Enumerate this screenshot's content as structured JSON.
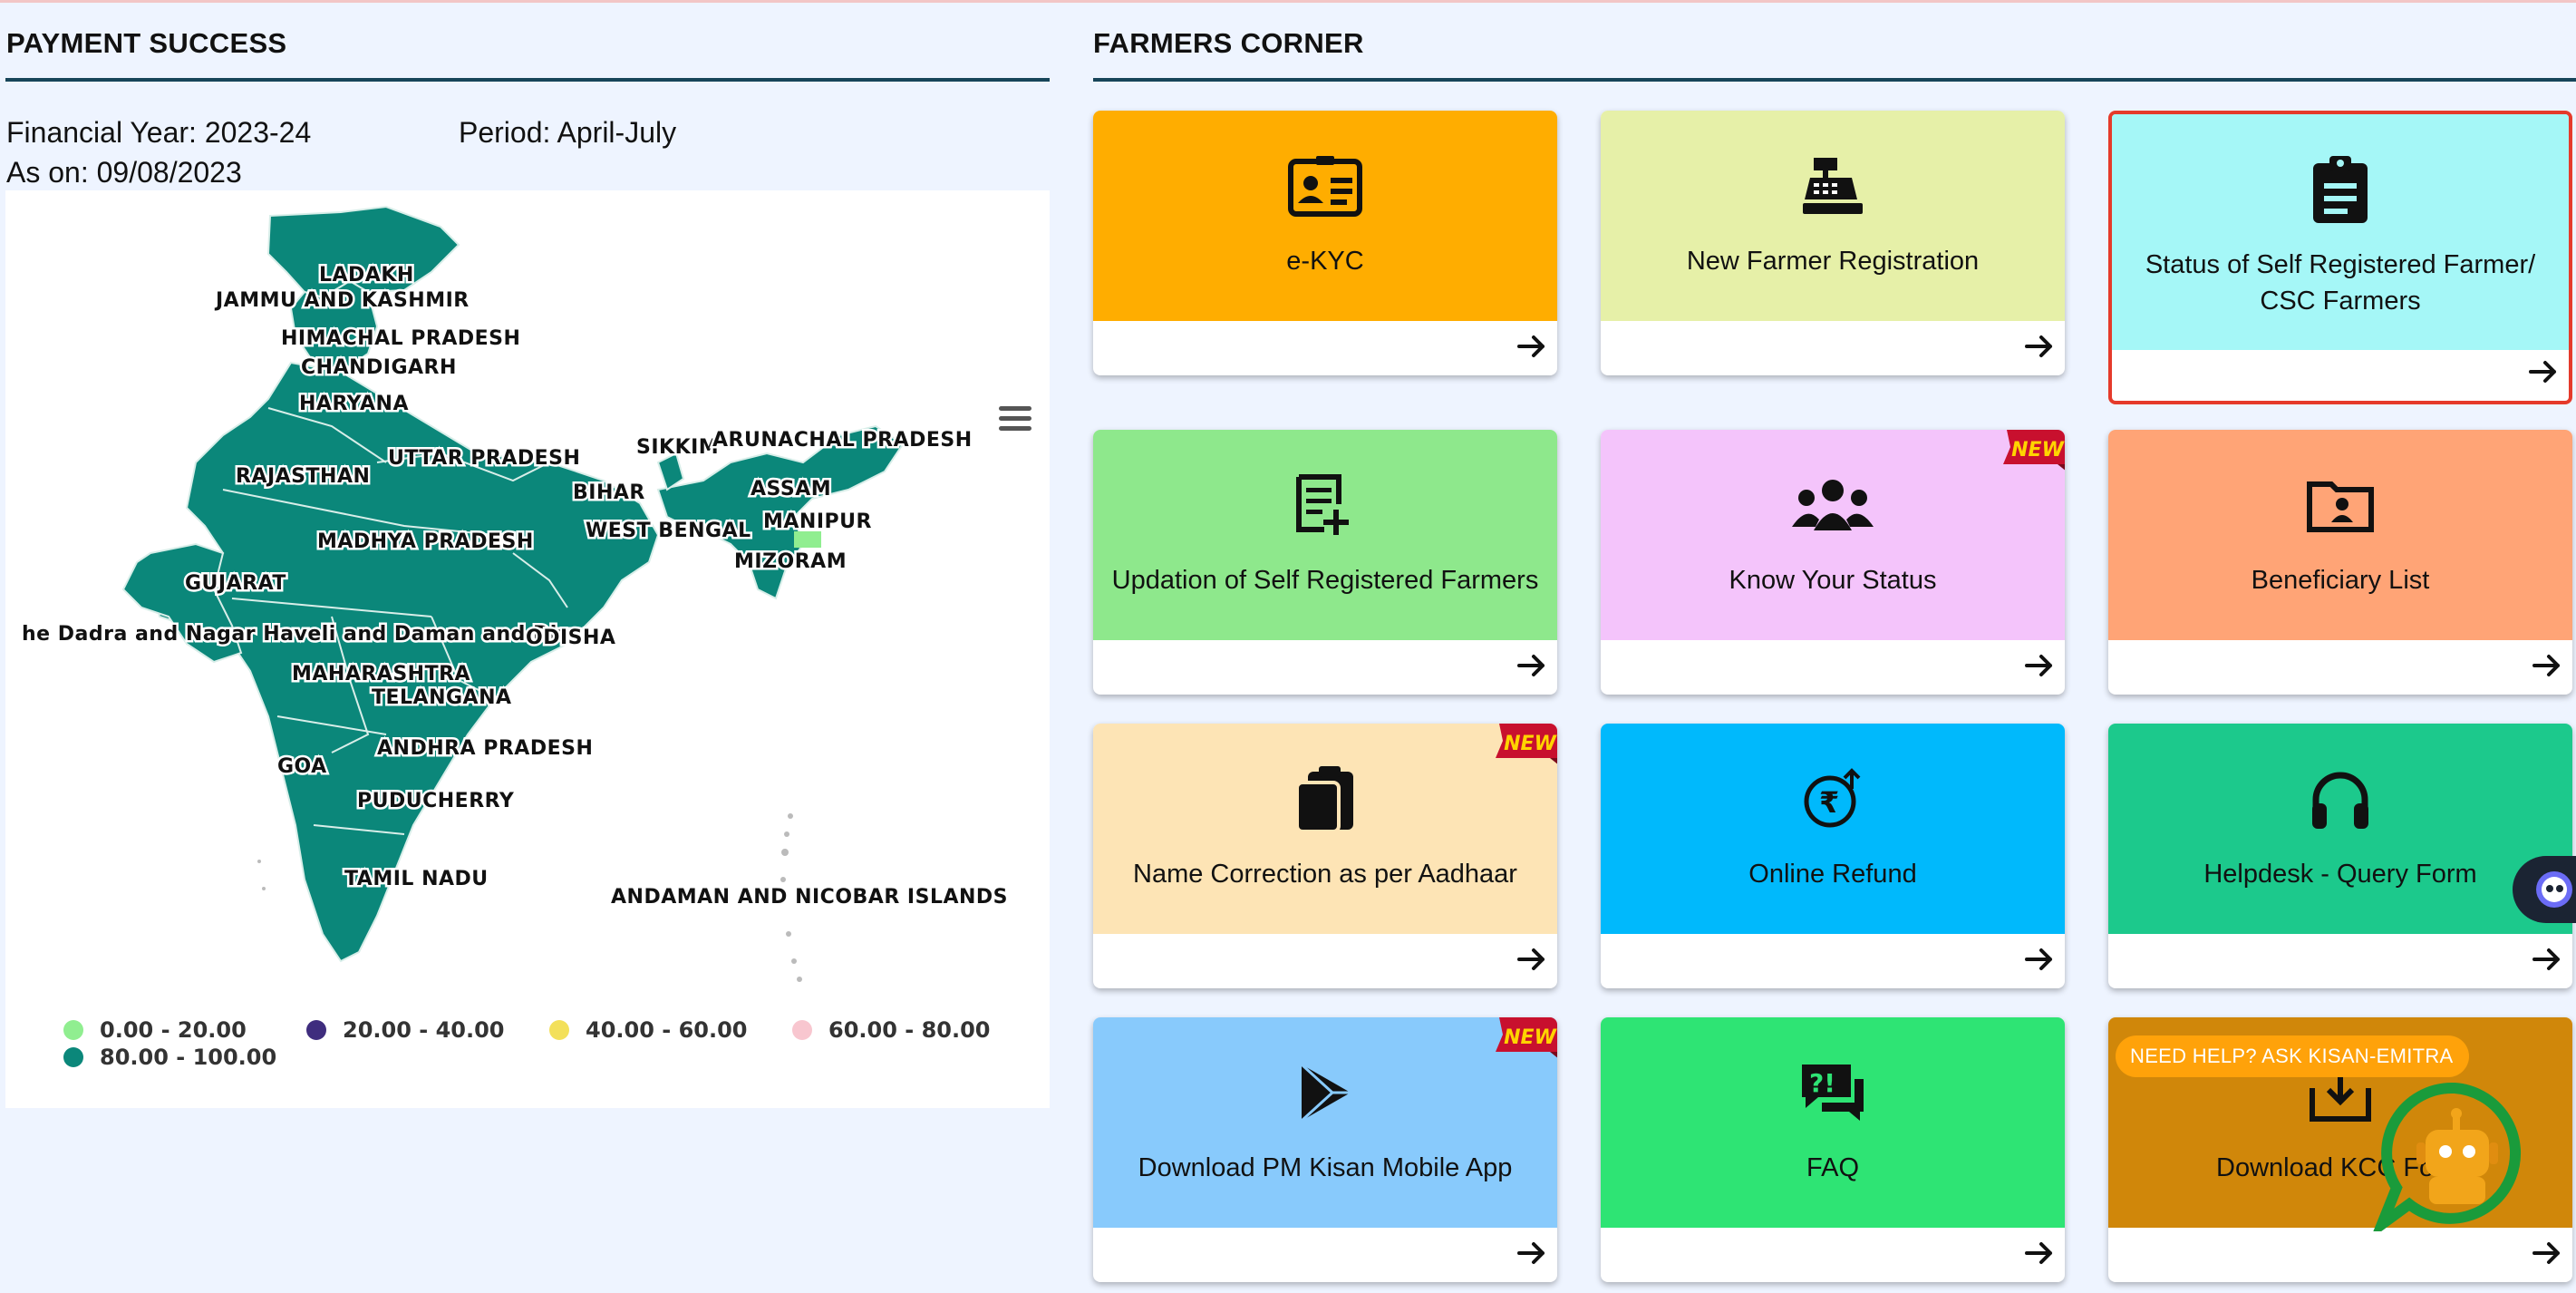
{
  "payment": {
    "title": "PAYMENT SUCCESS",
    "financial_year": "Financial Year: 2023-24",
    "period": "Period: April-July",
    "as_on": "As on: 09/08/2023",
    "state_labels": {
      "ladakh": "LADAKH",
      "jk": "JAMMU AND KASHMIR",
      "hp": "HIMACHAL PRADESH",
      "chandigarh": "CHANDIGARH",
      "haryana": "HARYANA",
      "up": "UTTAR PRADESH",
      "rajasthan": "RAJASTHAN",
      "sikkim": "SIKKIM",
      "arunachal": "ARUNACHAL PRADESH",
      "assam": "ASSAM",
      "bihar": "BIHAR",
      "wb": "WEST BENGAL",
      "manipur": "MANIPUR",
      "mp": "MADHYA PRADESH",
      "mizoram": "MIZORAM",
      "gujarat": "GUJARAT",
      "dnh": "he Dadra and Nagar Haveli and Daman and Diu",
      "odisha": "ODISHA",
      "maharashtra": "MAHARASHTRA",
      "telangana": "TELANGANA",
      "goa": "GOA",
      "ap": "ANDHRA PRADESH",
      "puducherry": "PUDUCHERRY",
      "tn": "TAMIL NADU",
      "andaman": "ANDAMAN AND NICOBAR ISLANDS"
    },
    "legend": [
      {
        "label": "0.00 - 20.00",
        "color": "#90ee90"
      },
      {
        "label": "20.00 - 40.00",
        "color": "#3f2d7e"
      },
      {
        "label": "40.00 - 60.00",
        "color": "#f3e05a"
      },
      {
        "label": "60.00 - 80.00",
        "color": "#f8c6cf"
      },
      {
        "label": "80.00 - 100.00",
        "color": "#0b877a"
      }
    ],
    "map_color": "#0b877a"
  },
  "farmers": {
    "title": "FARMERS CORNER",
    "cards": [
      {
        "label": "e-KYC",
        "color": "#ffad00",
        "icon": "id-card-icon"
      },
      {
        "label": "New Farmer Registration",
        "color": "#e6f0a8",
        "icon": "cash-register-icon"
      },
      {
        "label": "Status of Self Registered Farmer/ CSC Farmers",
        "color": "#a5f7f7",
        "icon": "clipboard-list-icon"
      },
      {
        "label": "Updation of Self Registered Farmers",
        "color": "#8ee88c",
        "icon": "file-plus-icon"
      },
      {
        "label": "Know Your Status",
        "color": "#f4c4fb",
        "icon": "users-icon"
      },
      {
        "label": "Beneficiary List",
        "color": "#ffa476",
        "icon": "folder-user-icon"
      },
      {
        "label": "Name Correction as per Aadhaar",
        "color": "#fde4b5",
        "icon": "paste-icon"
      },
      {
        "label": "Online Refund",
        "color": "#00b9fc",
        "icon": "rupee-refund-icon"
      },
      {
        "label": "Helpdesk - Query Form",
        "color": "#1cc98c",
        "icon": "headphones-icon"
      },
      {
        "label": "Download PM Kisan Mobile App",
        "color": "#88cafc",
        "icon": "play-store-icon"
      },
      {
        "label": "FAQ",
        "color": "#2ee474",
        "icon": "faq-icon"
      },
      {
        "label": "Download KCC Form",
        "color": "#d0870a",
        "icon": "download-icon"
      }
    ],
    "badge_text": "NEW"
  },
  "help": {
    "bubble": "NEED HELP? ASK KISAN-EMITRA"
  }
}
